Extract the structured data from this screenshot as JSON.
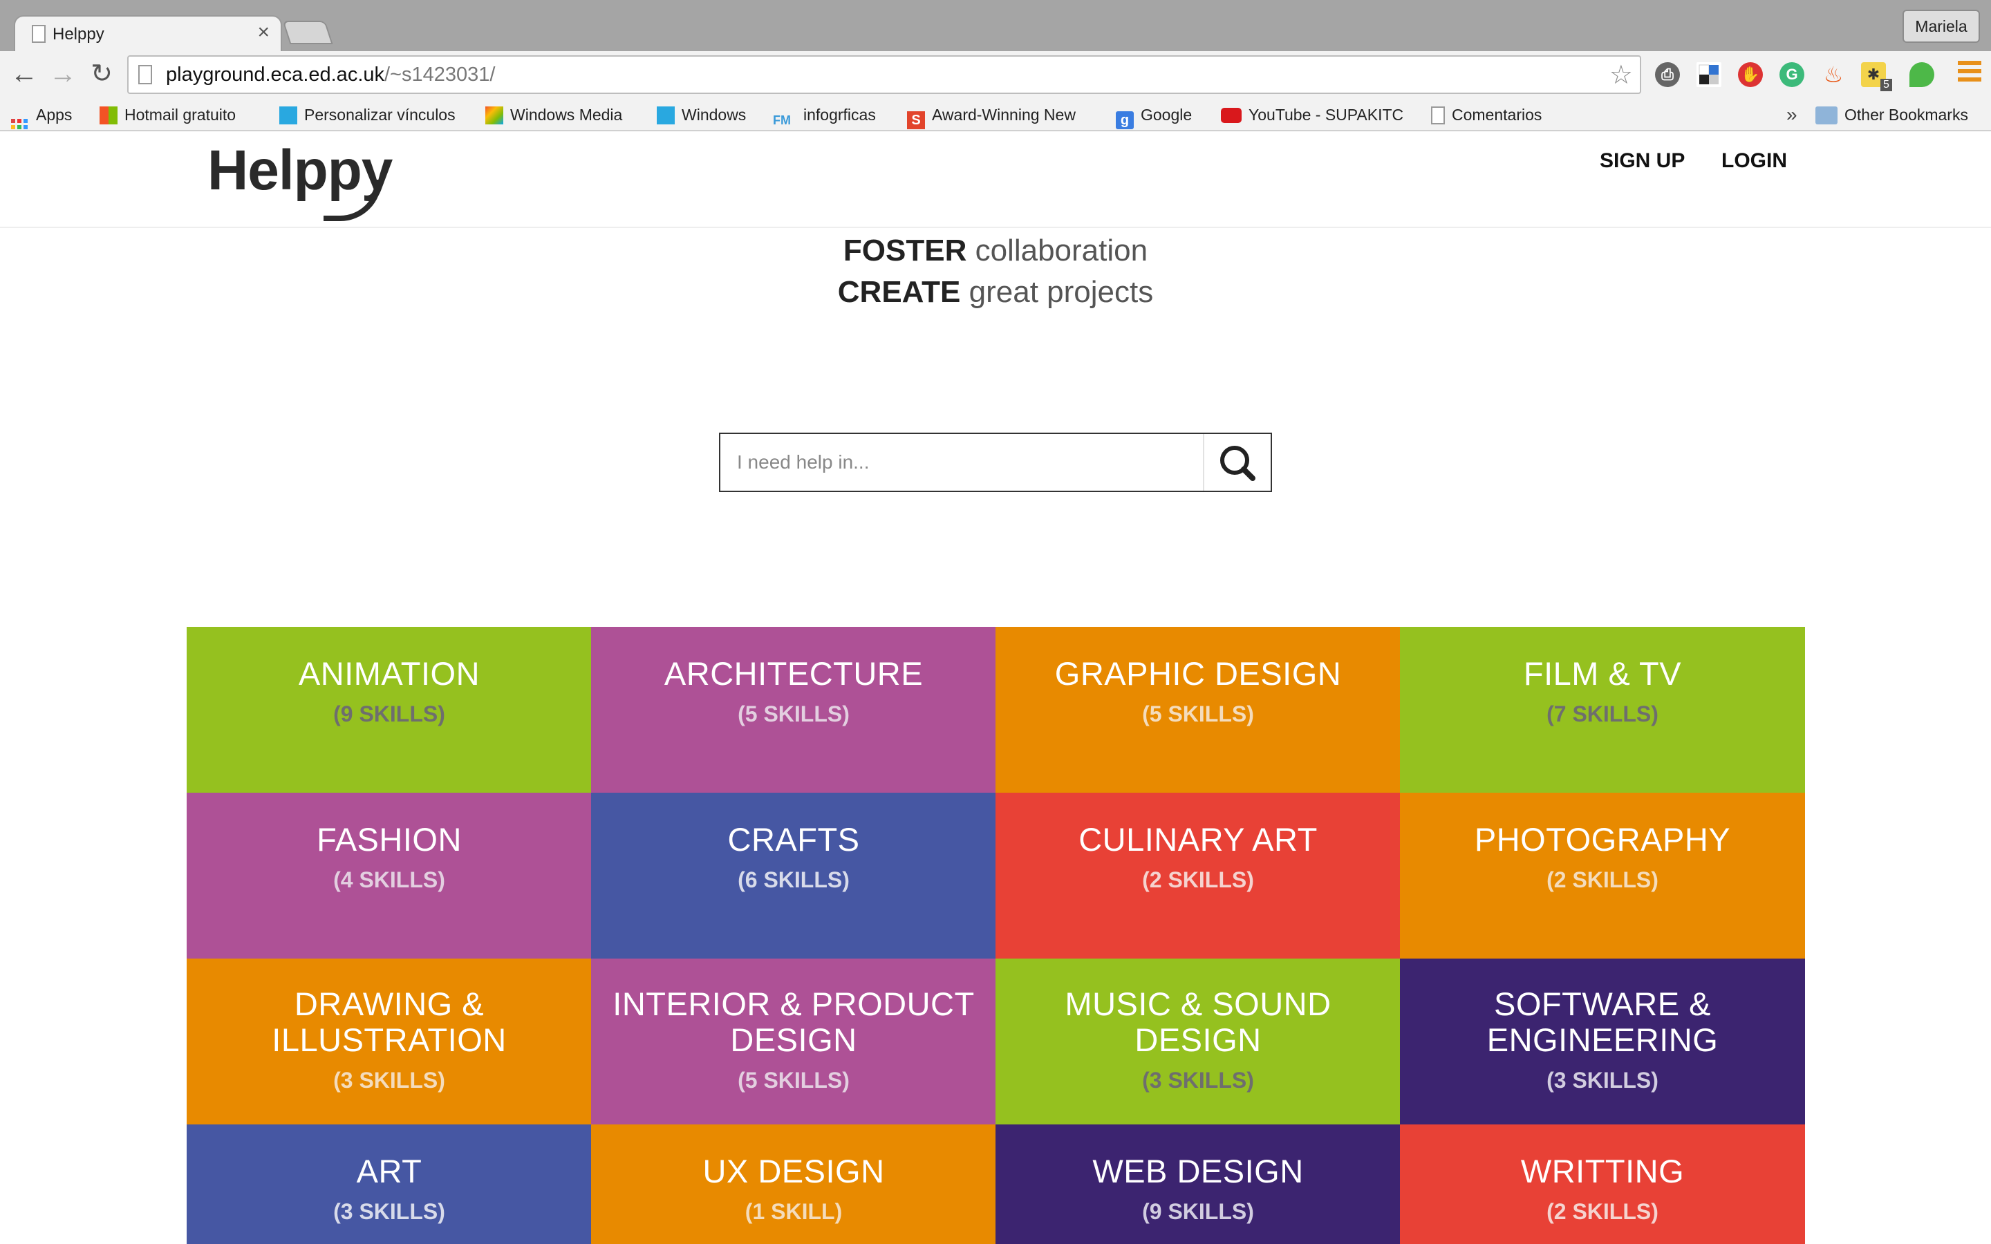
{
  "browser": {
    "tab_title": "Helppy",
    "tab_close": "×",
    "profile_name": "Mariela",
    "url_host": "playground.eca.ed.ac.uk",
    "url_path": "/~s1423031/",
    "star_glyph": "☆",
    "back_glyph": "←",
    "forward_glyph": "→",
    "reload_glyph": "↻",
    "bookmarks": [
      {
        "label": "Apps"
      },
      {
        "label": "Hotmail gratuito"
      },
      {
        "label": "Personalizar vínculos"
      },
      {
        "label": "Windows Media"
      },
      {
        "label": "Windows"
      },
      {
        "label": "infogrficas"
      },
      {
        "label": "Award-Winning New"
      },
      {
        "label": "Google"
      },
      {
        "label": "YouTube - SUPAKITC"
      },
      {
        "label": "Comentarios"
      }
    ],
    "overflow_glyph": "»",
    "other_bookmarks": "Other Bookmarks",
    "extension_badge": "5"
  },
  "site": {
    "logo": "Helppy",
    "nav": {
      "signup": "SIGN UP",
      "login": "LOGIN"
    },
    "tagline": [
      {
        "bold": "FOSTER",
        "rest": " collaboration"
      },
      {
        "bold": "CREATE",
        "rest": " great projects"
      }
    ],
    "search": {
      "placeholder": "I need help in..."
    }
  },
  "colors": {
    "green": "#95c11f",
    "magenta": "#ae5196",
    "orange": "#e88a00",
    "blue": "#4657a3",
    "red": "#e84136",
    "purple": "#3c2470"
  },
  "categories": [
    {
      "name": "ANIMATION",
      "count": "(9 SKILLS)",
      "color": "green",
      "count_color": "#6e6e6e"
    },
    {
      "name": "ARCHITECTURE",
      "count": "(5 SKILLS)",
      "color": "magenta",
      "count_color": "#e3cfe0"
    },
    {
      "name": "GRAPHIC DESIGN",
      "count": "(5 SKILLS)",
      "color": "orange",
      "count_color": "#f4dcbc"
    },
    {
      "name": "FILM & TV",
      "count": "(7 SKILLS)",
      "color": "green",
      "count_color": "#6e6e6e"
    },
    {
      "name": "FASHION",
      "count": "(4 SKILLS)",
      "color": "magenta",
      "count_color": "#e3cfe0"
    },
    {
      "name": "CRAFTS",
      "count": "(6 SKILLS)",
      "color": "blue",
      "count_color": "#d8dbea"
    },
    {
      "name": "CULINARY ART",
      "count": "(2 SKILLS)",
      "color": "red",
      "count_color": "#f5d3cf"
    },
    {
      "name": "PHOTOGRAPHY",
      "count": "(2 SKILLS)",
      "color": "orange",
      "count_color": "#f4dcbc"
    },
    {
      "name": "DRAWING & ILLUSTRATION",
      "count": "(3 SKILLS)",
      "color": "orange",
      "count_color": "#f4dcbc"
    },
    {
      "name": "INTERIOR & PRODUCT DESIGN",
      "count": "(5 SKILLS)",
      "color": "magenta",
      "count_color": "#e3cfe0"
    },
    {
      "name": "MUSIC & SOUND DESIGN",
      "count": "(3 SKILLS)",
      "color": "green",
      "count_color": "#6e6e6e"
    },
    {
      "name": "SOFTWARE & ENGINEERING",
      "count": "(3 SKILLS)",
      "color": "purple",
      "count_color": "#d2cde0"
    },
    {
      "name": "ART",
      "count": "(3 SKILLS)",
      "color": "blue",
      "count_color": "#d8dbea"
    },
    {
      "name": "UX DESIGN",
      "count": "(1 SKILL)",
      "color": "orange",
      "count_color": "#f4dcbc"
    },
    {
      "name": "WEB DESIGN",
      "count": "(9 SKILLS)",
      "color": "purple",
      "count_color": "#d2cde0"
    },
    {
      "name": "WRITTING",
      "count": "(2 SKILLS)",
      "color": "red",
      "count_color": "#f5d3cf"
    }
  ]
}
